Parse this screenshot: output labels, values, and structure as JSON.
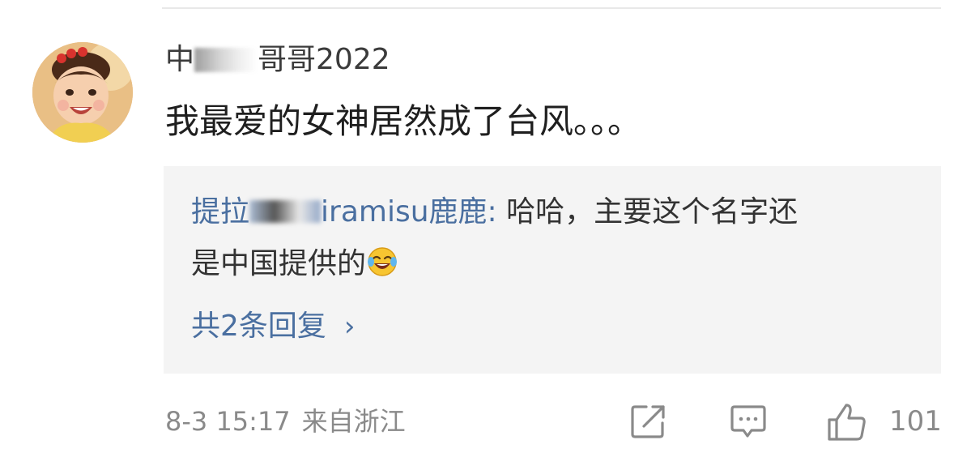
{
  "comment": {
    "username_prefix": "中",
    "username_suffix": "哥哥2022",
    "text": "我最爱的女神居然成了台风。。。",
    "timestamp": "8-3 15:17",
    "location": "来自浙江",
    "like_count": "101"
  },
  "reply": {
    "author_prefix": "提拉",
    "author_suffix": "iramisu鹿鹿",
    "separator": ":",
    "line1_text": " 哈哈，主要这个名字还",
    "line2_text": "是中国提供的",
    "emoji": "laugh-cry-emoji",
    "more_label": "共2条回复",
    "more_chevron": "›"
  },
  "icons": {
    "share": "share-icon",
    "comment": "comment-icon",
    "like": "thumbs-up-icon"
  },
  "colors": {
    "link": "#4a6fa0",
    "meta": "#8a8a8a",
    "reply_bg": "#f4f4f4"
  }
}
